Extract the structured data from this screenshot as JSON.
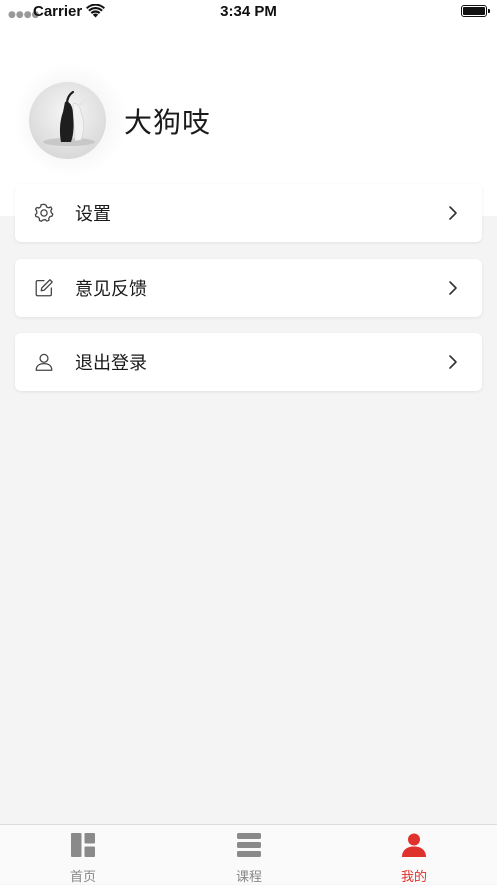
{
  "status_bar": {
    "carrier": "Carrier",
    "time": "3:34 PM"
  },
  "profile": {
    "username": "大狗吱"
  },
  "menu": [
    {
      "label": "设置",
      "icon": "gear-icon"
    },
    {
      "label": "意见反馈",
      "icon": "edit-icon"
    },
    {
      "label": "退出登录",
      "icon": "user-icon"
    }
  ],
  "tabs": [
    {
      "label": "首页",
      "icon": "grid-icon"
    },
    {
      "label": "课程",
      "icon": "list-icon"
    },
    {
      "label": "我的",
      "icon": "person-icon"
    }
  ],
  "active_tab": "我的",
  "colors": {
    "accent": "#e0322c",
    "background": "#f4f4f4",
    "inactive_tab": "#888888"
  }
}
